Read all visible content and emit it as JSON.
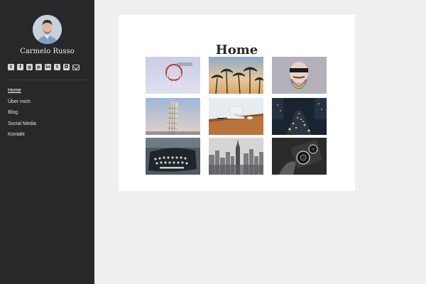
{
  "sidebar": {
    "author_name": "Carmelo Russo",
    "social_icons": [
      "twitter-icon",
      "facebook-icon",
      "google-plus-icon",
      "pinterest-icon",
      "linkedin-icon",
      "tumblr-icon",
      "instagram-icon",
      "mail-icon"
    ],
    "nav": [
      {
        "label": "Home",
        "active": true
      },
      {
        "label": "Über mich",
        "active": false
      },
      {
        "label": "Blog",
        "active": false
      },
      {
        "label": "Social Media",
        "active": false
      },
      {
        "label": "Kontakt",
        "active": false
      }
    ]
  },
  "main": {
    "title": "Home",
    "gallery": [
      "basketball-hoop-image",
      "palm-trees-image",
      "bearded-man-illustration-image",
      "leaning-tower-image",
      "desk-workspace-image",
      "city-night-street-image",
      "typewriter-image",
      "city-skyline-image",
      "vintage-camera-image"
    ]
  }
}
